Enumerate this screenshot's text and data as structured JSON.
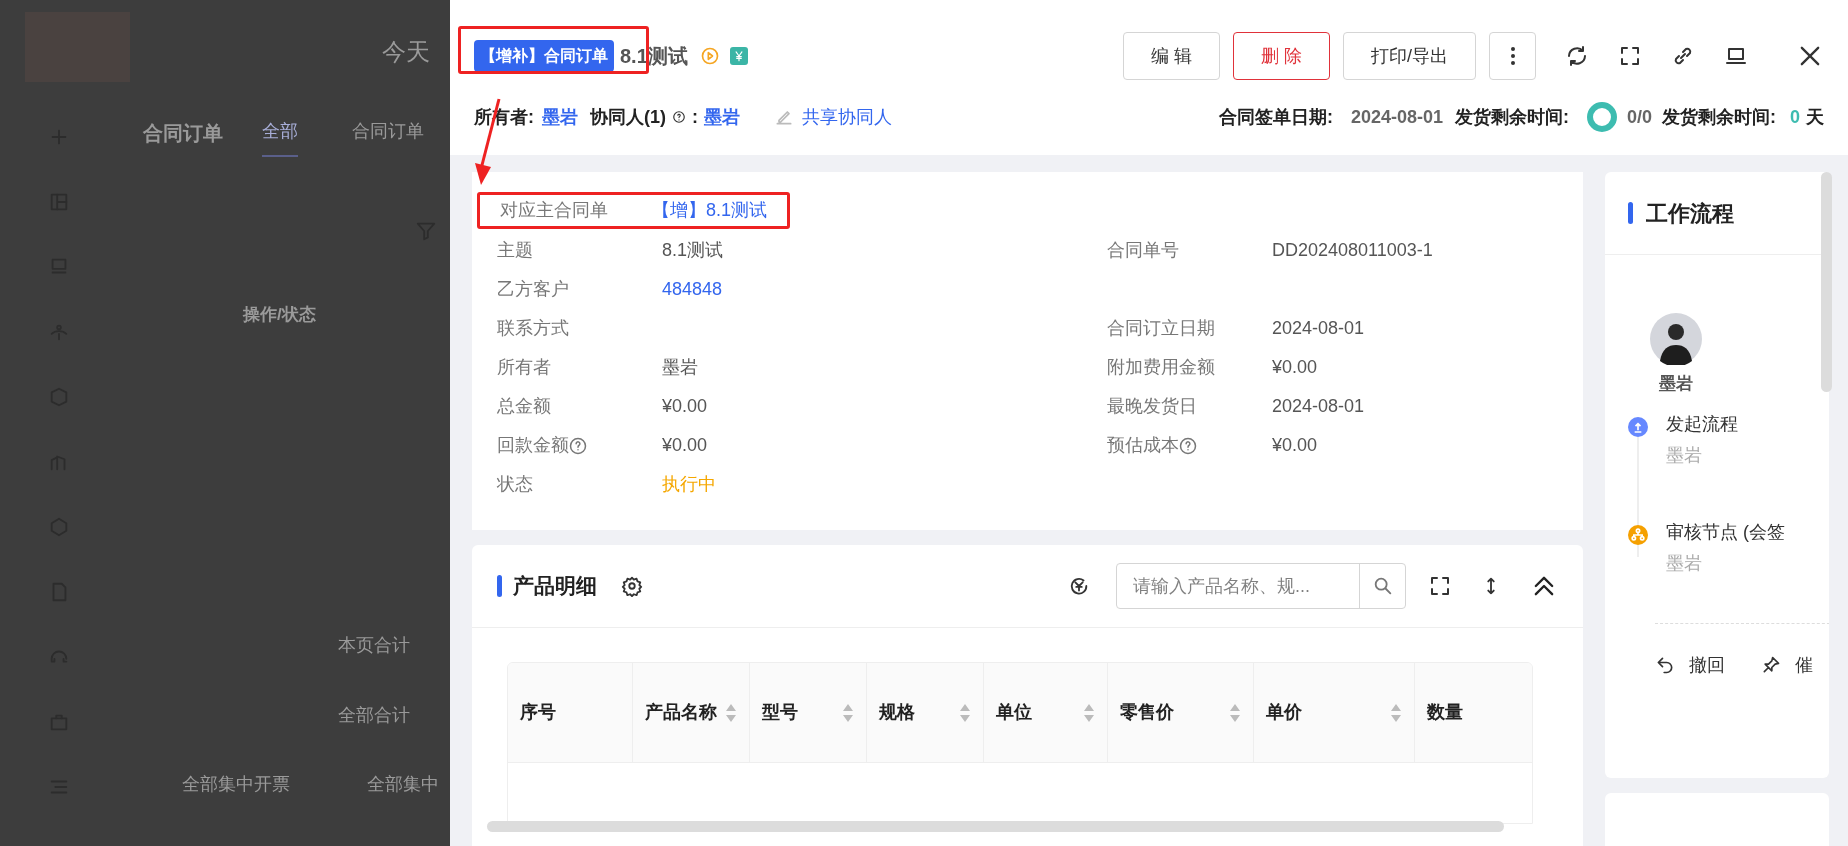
{
  "background_page": {
    "heading": "今天",
    "title": "合同订单",
    "tabs": [
      {
        "label": "全部",
        "selected": true
      },
      {
        "label": "合同订单",
        "selected": false
      }
    ],
    "column_header": "操作/状态",
    "totals": [
      "本页合计",
      "全部合计"
    ],
    "footer": [
      "全部集中开票",
      "全部集中"
    ]
  },
  "drawer": {
    "title_tag": "【增补】合同订单",
    "title": "8.1测试",
    "buttons": [
      {
        "label": "编 辑",
        "kind": "default"
      },
      {
        "label": "删 除",
        "kind": "danger"
      },
      {
        "label": "打印/导出",
        "kind": "default"
      }
    ],
    "owner_label": "所有者:",
    "owner": "墨岩",
    "collaborators_label": "协同人(1)",
    "collaborators_colon": ":",
    "collaborator": "墨岩",
    "share_link": "共享协同人",
    "sign_date_label": "合同签单日期:",
    "sign_date": "2024-08-01",
    "remaining_label": "发货剩余时间:",
    "progress": "0/0",
    "remaining_label_2": "发货剩余时间:",
    "remaining_days": "0",
    "remaining_unit": "天"
  },
  "details": {
    "main_contract": {
      "label": "对应主合同单",
      "value": "【增】8.1测试"
    },
    "rows": [
      {
        "left": {
          "label": "主题",
          "value": "8.1测试",
          "kind": "text",
          "help": false
        },
        "right": {
          "label": "合同单号",
          "value": "DD202408011003-1",
          "kind": "text",
          "help": false
        }
      },
      {
        "left": {
          "label": "乙方客户",
          "value": "484848",
          "kind": "link",
          "help": false
        },
        "right": null
      },
      {
        "left": {
          "label": "联系方式",
          "kind": "text",
          "help": false
        },
        "right": {
          "label": "合同订立日期",
          "value": "2024-08-01",
          "kind": "text",
          "help": false
        }
      },
      {
        "left": {
          "label": "所有者",
          "value": "墨岩",
          "kind": "text",
          "help": false
        },
        "right": {
          "label": "附加费用金额",
          "value": "¥0.00",
          "kind": "text",
          "help": false
        }
      },
      {
        "left": {
          "label": "总金额",
          "value": "¥0.00",
          "kind": "text",
          "help": false
        },
        "right": {
          "label": "最晚发货日",
          "value": "2024-08-01",
          "kind": "text",
          "help": false
        }
      },
      {
        "left": {
          "label": "回款金额",
          "value": "¥0.00",
          "kind": "text",
          "help": true
        },
        "right": {
          "label": "预估成本",
          "value": "¥0.00",
          "kind": "text",
          "help": true
        }
      },
      {
        "left": {
          "label": "状态",
          "value": "执行中",
          "kind": "status",
          "help": false
        },
        "right": null
      }
    ]
  },
  "products": {
    "title": "产品明细",
    "search": {
      "placeholder": "请输入产品名称、规..."
    },
    "columns": [
      {
        "label": "序号",
        "sortable": false
      },
      {
        "label": "产品名称",
        "sortable": true
      },
      {
        "label": "型号",
        "sortable": true
      },
      {
        "label": "规格",
        "sortable": true
      },
      {
        "label": "单位",
        "sortable": true
      },
      {
        "label": "零售价",
        "sortable": true
      },
      {
        "label": "单价",
        "sortable": true
      },
      {
        "label": "数量",
        "sortable": false
      }
    ]
  },
  "workflow": {
    "title": "工作流程",
    "user": "墨岩",
    "steps": [
      {
        "title": "发起流程",
        "user": "墨岩",
        "kind": "start"
      },
      {
        "title": "审核节点 (会签",
        "user": "墨岩",
        "kind": "review"
      }
    ],
    "actions": [
      {
        "label": "撤回",
        "kind": "undo"
      },
      {
        "label": "催",
        "kind": "pin"
      }
    ]
  }
}
